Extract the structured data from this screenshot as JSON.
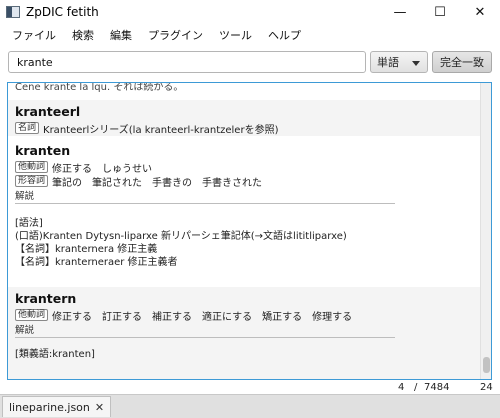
{
  "window": {
    "title": "ZpDIC fetith",
    "minimize_glyph": "—",
    "maximize_glyph": "☐",
    "close_glyph": "✕"
  },
  "menu": {
    "items": [
      "ファイル",
      "検索",
      "編集",
      "プラグイン",
      "ツール",
      "ヘルプ"
    ]
  },
  "search": {
    "value": "krante",
    "mode": "単語",
    "exact_label": "完全一致"
  },
  "results": {
    "cut_line": "Cene krante la lqu. それは続かる。",
    "entries": [
      {
        "headword": "kranteerl",
        "rows": [
          {
            "tag": "名詞",
            "terms": [
              "Kranteerlシリーズ(la kranteerl-krantzelerを参照)"
            ]
          }
        ]
      },
      {
        "headword": "kranten",
        "rows": [
          {
            "tag": "他動詞",
            "terms": [
              "修正する",
              "しゅうせい"
            ]
          },
          {
            "tag": "形容詞",
            "terms": [
              "筆記の",
              "筆記された",
              "手書きの",
              "手書きされた"
            ]
          }
        ],
        "section_label": "解説",
        "info": [
          "[語法]",
          "(口語)Kranten Dytysn-liparxe 新リパーシェ筆記体(→文語はlititliparxe)",
          "【名詞】kranternera 修正主義",
          "【名詞】kranterneraer 修正主義者"
        ]
      },
      {
        "headword": "krantern",
        "rows": [
          {
            "tag": "他動詞",
            "terms": [
              "修正する",
              "訂正する",
              "補正する",
              "適正にする",
              "矯正する",
              "修理する"
            ]
          }
        ],
        "section_label": "解説",
        "info": [
          "[類義語:kranten]"
        ]
      }
    ]
  },
  "status": {
    "current": "4",
    "separator": "/",
    "total": "7484",
    "time": "24"
  },
  "tabs": [
    {
      "label": "lineparine.json",
      "close_glyph": "✕"
    }
  ]
}
